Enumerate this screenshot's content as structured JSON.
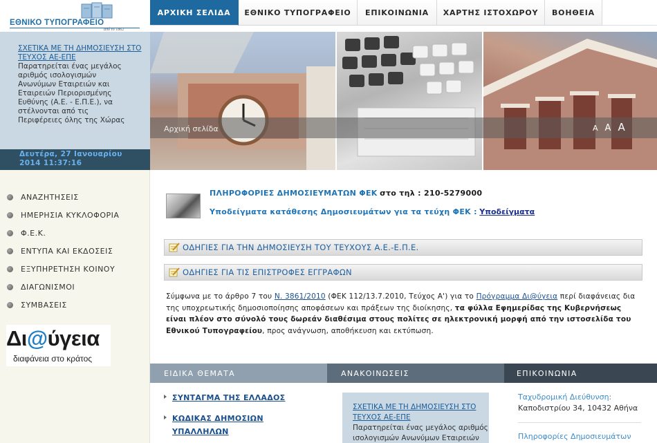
{
  "logo": {
    "name": "ΕΘΝΙΚΟ ΤΥΠΟΓΡΑΦΕΙΟ",
    "since": "από το 1862"
  },
  "nav": {
    "tabs": [
      {
        "label": "ΑΡΧΙΚΗ ΣΕΛΙΔΑ",
        "active": true
      },
      {
        "label": "ΕΘΝΙΚΟ ΤΥΠΟΓΡΑΦΕΙΟ",
        "active": false
      },
      {
        "label": "ΕΠΙΚΟΙΝΩΝΙΑ",
        "active": false
      },
      {
        "label": "ΧΑΡΤΗΣ ΙΣΤΟΧΩΡΟΥ",
        "active": false
      },
      {
        "label": "ΒΟΗΘΕΙΑ",
        "active": false
      }
    ]
  },
  "banner": {
    "news_link": "ΣΧΕΤΙΚΑ ΜΕ ΤΗ ΔΗΜΟΣΙΕΥΣΗ ΣΤΟ ΤΕΥΧΟΣ ΑΕ-ΕΠΕ",
    "news_lines": [
      "Παρατηρείται ένας μεγάλος",
      "αριθμός ισολογισμών",
      "Ανωνύμων Εταιρειών και",
      "Εταιρειών Περιορισμένης",
      "Ευθύνης (Α.Ε. - Ε.Π.Ε.), να",
      "στέλνονται από τις",
      "Περιφέρειες όλης της Χώρας"
    ],
    "date_line1": "Δευτέρα, 27 Ιανουαρίου",
    "date_line2": "2014 11:37:16",
    "breadcrumb": "Αρχική σελίδα",
    "font_small": "A",
    "font_medium": "A",
    "font_large": "A"
  },
  "sidebar": {
    "items": [
      {
        "label": "ΑΝΑΖΗΤΗΣΕΙΣ"
      },
      {
        "label": "ΗΜΕΡΗΣΙΑ ΚΥΚΛΟΦΟΡΙΑ"
      },
      {
        "label": "Φ.Ε.Κ."
      },
      {
        "label": "ΕΝΤΥΠΑ ΚΑΙ ΕΚΔΟΣΕΙΣ"
      },
      {
        "label": "ΕΞΥΠΗΡΕΤΗΣΗ ΚΟΙΝΟΥ"
      },
      {
        "label": "ΔΙΑΓΩΝΙΣΜΟΙ"
      },
      {
        "label": "ΣΥΜΒΑΣΕΙΣ"
      }
    ],
    "diavgeia_prefix": "Δι",
    "diavgeia_at": "@",
    "diavgeia_suffix": "ύγεια",
    "diavgeia_tagline": "διαφάνεια στο κράτος"
  },
  "main": {
    "info_title": "ΠΛΗΡΟΦΟΡΙΕΣ ΔΗΜΟΣΙΕΥΜΑΤΩΝ ΦΕΚ",
    "info_phone": "στο τηλ : 210-5279000",
    "templates_text": "Υποδείγματα κατάθεσης Δημοσιευμάτων για τα τεύχη ΦΕΚ :",
    "templates_link": "Υποδείγματα",
    "guide1": "ΟΔΗΓΙΕΣ ΓΙΑ ΤΗΝ ΔΗΜΟΣΙΕΥΣΗ ΤΟΥ ΤΕΥΧΟΥΣ Α.Ε.-Ε.Π.Ε.",
    "guide2": "ΟΔΗΓΙΕΣ ΓΙΑ ΤΙΣ ΕΠΙΣΤΡΟΦΕΣ ΕΓΓΡΑΦΩΝ",
    "para_1": "Σύμφωνα με το άρθρο 7 του ",
    "para_law": "Ν. 3861/2010",
    "para_2": " (ΦΕΚ 112/13.7.2010, Τεύχος Α') για το ",
    "para_program": "Πρόγραμμα Δι@ύγεια",
    "para_3": " περί διαφάνειας δια της υποχρεωτικής δημοσιοποίησης αποφάσεων και πράξεων της διοίκησης, ",
    "para_bold": "τα φύλλα Εφημερίδας της Κυβερνήσεως είναι πλέον στο σύνολό τους δωρεάν διαθέσιμα στους πολίτες σε ηλεκτρονική μορφή από την ιστοσελίδα του Εθνικού Τυπογραφείου",
    "para_4": ", προς ανάγνωση, αποθήκευση και εκτύπωση."
  },
  "columns": {
    "special_title": "ΕΙΔΙΚΑ ΘΕΜΑΤΑ",
    "special_items": [
      {
        "label": "ΣΥΝΤΑΓΜΑ ΤΗΣ ΕΛΛΑΔΟΣ"
      },
      {
        "label_line1": "ΚΩΔΙΚΑΣ ΔΗΜΟΣΙΩΝ",
        "label_line2": "ΥΠΑΛΛΗΛΩΝ"
      }
    ],
    "announcements_title": "ΑΝΑΚΟΙΝΩΣΕΙΣ",
    "announcement_link_line1": "ΣΧΕΤΙΚΑ ΜΕ ΤΗ ΔΗΜΟΣΙΕΥΣΗ ΣΤΟ",
    "announcement_link_line2": "ΤΕΥΧΟΣ ΑΕ-ΕΠΕ",
    "announcement_body_line1": "Παρατηρείται ένας μεγάλος αριθμός",
    "announcement_body_line2": "ισολογισμών Ανωνύμων Εταιρειών",
    "contact_title": "ΕΠΙΚΟΙΝΩΝΙΑ",
    "postal_label": "Ταχυδρομική Διεύθυνση:",
    "postal_value": "Καποδιστρίου 34, 10432 Αθήνα",
    "info_label": "Πληροφορίες Δημοσιευμάτων"
  },
  "colors": {
    "accent": "#1e6aa0",
    "panel_blue": "#c9d8e3",
    "date_bar": "#2f4f63",
    "sidebar_bg": "#f6f6ec"
  }
}
